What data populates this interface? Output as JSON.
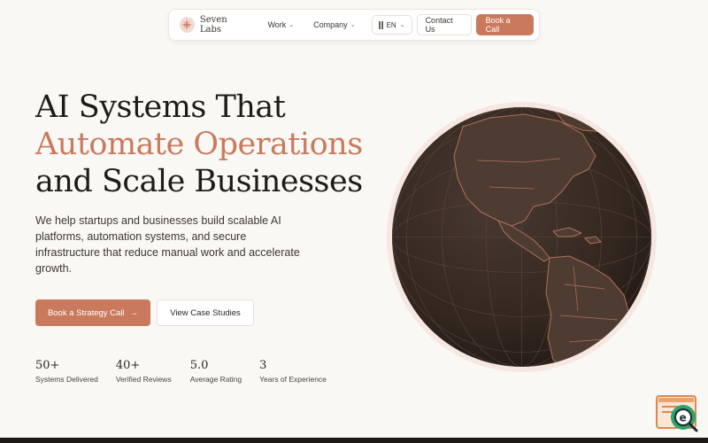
{
  "brand": {
    "name": "Seven Labs"
  },
  "nav": {
    "work": "Work",
    "company": "Company",
    "lang": "EN",
    "contact": "Contact Us",
    "cta": "Book a Call"
  },
  "hero": {
    "line1": "AI Systems That",
    "line2": "Automate Operations",
    "line3": "and Scale Businesses",
    "description": "We help startups and businesses build scalable AI platforms, automation systems, and secure infrastructure that reduce manual work and accelerate growth.",
    "primary_cta": "Book a Strategy Call",
    "primary_cta_arrow": "→",
    "secondary_cta": "View Case Studies"
  },
  "stats": [
    {
      "value": "50+",
      "label": "Systems Delivered"
    },
    {
      "value": "40+",
      "label": "Verified Reviews"
    },
    {
      "value": "5.0",
      "label": "Average Rating"
    },
    {
      "value": "3",
      "label": "Years of Experience"
    }
  ],
  "icons": {
    "chevron": "chevron-down-icon",
    "arrow": "arrow-right-icon",
    "globe": "globe-illustration",
    "chat": "chat-widget-icon"
  },
  "colors": {
    "accent": "#c97a5c",
    "background": "#faf8f5",
    "globe_fill": "#3d302b",
    "globe_lines": "#a86b52"
  }
}
